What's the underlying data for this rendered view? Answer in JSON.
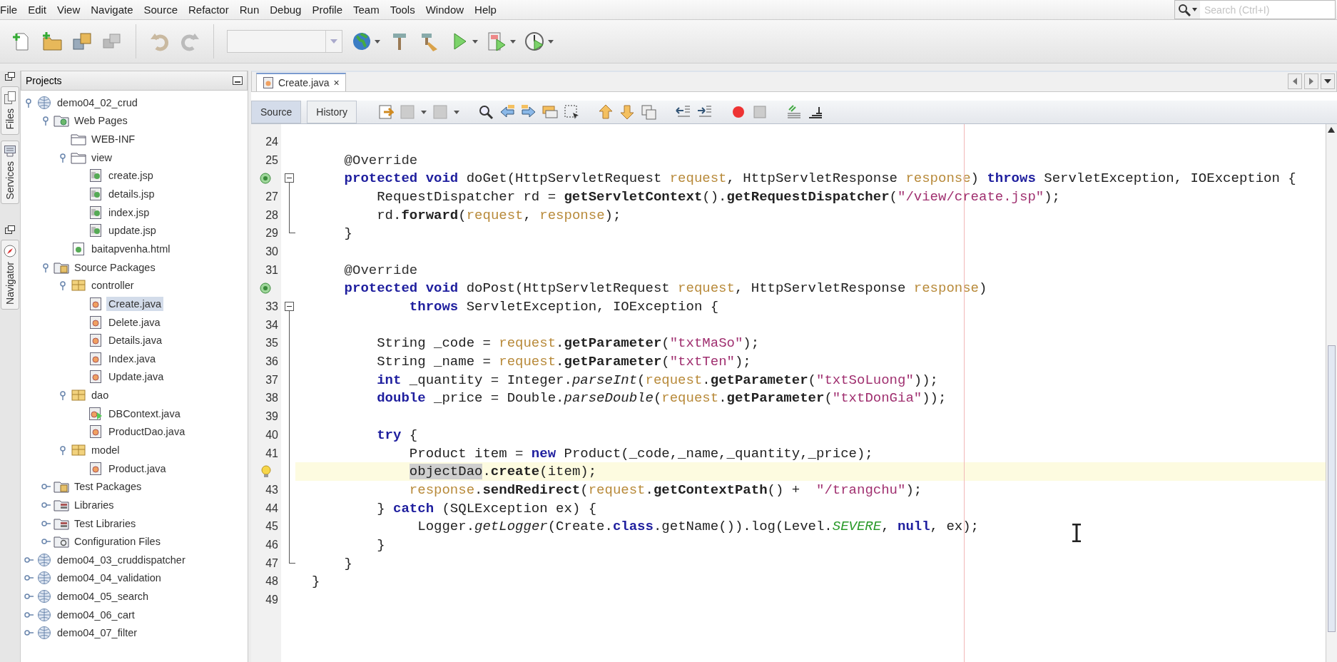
{
  "menu": [
    "File",
    "Edit",
    "View",
    "Navigate",
    "Source",
    "Refactor",
    "Run",
    "Debug",
    "Profile",
    "Team",
    "Tools",
    "Window",
    "Help"
  ],
  "search": {
    "placeholder": "Search (Ctrl+I)"
  },
  "side_tabs": [
    {
      "label": "Files"
    },
    {
      "label": "Services"
    },
    {
      "label": "Navigator"
    }
  ],
  "projects": {
    "title": "Projects",
    "tree": [
      {
        "label": "demo04_02_crud",
        "kind": "project",
        "selected": false,
        "expanded": true,
        "children": [
          {
            "label": "Web Pages",
            "kind": "web-pages",
            "selected": false,
            "expanded": true,
            "children": [
              {
                "label": "WEB-INF",
                "kind": "folder",
                "selected": false
              },
              {
                "label": "view",
                "kind": "folder",
                "selected": false,
                "expanded": true,
                "children": [
                  {
                    "label": "create.jsp",
                    "kind": "jsp",
                    "selected": false
                  },
                  {
                    "label": "details.jsp",
                    "kind": "jsp",
                    "selected": false
                  },
                  {
                    "label": "index.jsp",
                    "kind": "jsp",
                    "selected": false
                  },
                  {
                    "label": "update.jsp",
                    "kind": "jsp",
                    "selected": false
                  }
                ]
              },
              {
                "label": "baitapvenha.html",
                "kind": "html",
                "selected": false
              }
            ]
          },
          {
            "label": "Source Packages",
            "kind": "source-packages",
            "selected": false,
            "expanded": true,
            "children": [
              {
                "label": "controller",
                "kind": "package",
                "selected": false,
                "expanded": true,
                "children": [
                  {
                    "label": "Create.java",
                    "kind": "java",
                    "selected": true
                  },
                  {
                    "label": "Delete.java",
                    "kind": "java",
                    "selected": false
                  },
                  {
                    "label": "Details.java",
                    "kind": "java",
                    "selected": false
                  },
                  {
                    "label": "Index.java",
                    "kind": "java",
                    "selected": false
                  },
                  {
                    "label": "Update.java",
                    "kind": "java",
                    "selected": false
                  }
                ]
              },
              {
                "label": "dao",
                "kind": "package",
                "selected": false,
                "expanded": true,
                "children": [
                  {
                    "label": "DBContext.java",
                    "kind": "java-main",
                    "selected": false
                  },
                  {
                    "label": "ProductDao.java",
                    "kind": "java",
                    "selected": false
                  }
                ]
              },
              {
                "label": "model",
                "kind": "package",
                "selected": false,
                "expanded": true,
                "children": [
                  {
                    "label": "Product.java",
                    "kind": "java",
                    "selected": false
                  }
                ]
              }
            ]
          },
          {
            "label": "Test Packages",
            "kind": "test-packages",
            "selected": false,
            "expanded": false
          },
          {
            "label": "Libraries",
            "kind": "libraries",
            "selected": false,
            "expanded": false
          },
          {
            "label": "Test Libraries",
            "kind": "libraries",
            "selected": false,
            "expanded": false
          },
          {
            "label": "Configuration Files",
            "kind": "config",
            "selected": false,
            "expanded": false
          }
        ]
      },
      {
        "label": "demo04_03_cruddispatcher",
        "kind": "project",
        "selected": false,
        "expanded": false
      },
      {
        "label": "demo04_04_validation",
        "kind": "project",
        "selected": false,
        "expanded": false
      },
      {
        "label": "demo04_05_search",
        "kind": "project",
        "selected": false,
        "expanded": false
      },
      {
        "label": "demo04_06_cart",
        "kind": "project",
        "selected": false,
        "expanded": false
      },
      {
        "label": "demo04_07_filter",
        "kind": "project",
        "selected": false,
        "expanded": false
      }
    ]
  },
  "editor": {
    "tabs": [
      {
        "label": "Create.java",
        "selected": true,
        "close": "×"
      }
    ],
    "views": [
      {
        "label": "Source",
        "selected": true
      },
      {
        "label": "History",
        "selected": false
      }
    ],
    "lines": [
      {
        "number": "24",
        "kind": "plain",
        "current": false,
        "fold_start": false,
        "fold_end": false
      },
      {
        "number": "25",
        "kind": "plain",
        "current": false,
        "fold_start": false,
        "fold_end": false,
        "tokens": [
          {
            "text": "    @Override",
            "kind": "annotation"
          }
        ]
      },
      {
        "kind": "override",
        "current": false,
        "fold_start": true,
        "fold_end": false,
        "tokens": [
          {
            "text": "    protected",
            "kind": "keyword"
          },
          {
            "text": " void",
            "kind": "keyword"
          },
          {
            "text": " doGet(HttpServletRequest ",
            "kind": "plain"
          },
          {
            "text": "request",
            "kind": "param"
          },
          {
            "text": ", HttpServletResponse ",
            "kind": "plain"
          },
          {
            "text": "response",
            "kind": "param"
          },
          {
            "text": ") ",
            "kind": "plain"
          },
          {
            "text": "throws",
            "kind": "keyword"
          },
          {
            "text": " ServletException, IOException {",
            "kind": "plain"
          }
        ]
      },
      {
        "number": "27",
        "kind": "plain",
        "current": false,
        "fold_start": false,
        "fold_end": false,
        "tokens": [
          {
            "text": "        RequestDispatcher rd = ",
            "kind": "plain"
          },
          {
            "text": "getServletContext",
            "kind": "method"
          },
          {
            "text": "().",
            "kind": "plain"
          },
          {
            "text": "getRequestDispatcher",
            "kind": "method"
          },
          {
            "text": "(",
            "kind": "plain"
          },
          {
            "text": "\"/view/create.jsp\"",
            "kind": "string"
          },
          {
            "text": ");",
            "kind": "plain"
          }
        ]
      },
      {
        "number": "28",
        "kind": "plain",
        "current": false,
        "fold_start": false,
        "fold_end": false,
        "tokens": [
          {
            "text": "        rd.",
            "kind": "plain"
          },
          {
            "text": "forward",
            "kind": "method"
          },
          {
            "text": "(",
            "kind": "plain"
          },
          {
            "text": "request",
            "kind": "param"
          },
          {
            "text": ", ",
            "kind": "plain"
          },
          {
            "text": "response",
            "kind": "param"
          },
          {
            "text": ");",
            "kind": "plain"
          }
        ]
      },
      {
        "number": "29",
        "kind": "plain",
        "current": false,
        "fold_start": false,
        "fold_end": true,
        "tokens": [
          {
            "text": "    }",
            "kind": "plain"
          }
        ]
      },
      {
        "number": "30",
        "kind": "plain",
        "current": false,
        "fold_start": false,
        "fold_end": false
      },
      {
        "number": "31",
        "kind": "plain",
        "current": false,
        "fold_start": false,
        "fold_end": false,
        "tokens": [
          {
            "text": "    @Override",
            "kind": "annotation"
          }
        ]
      },
      {
        "kind": "override",
        "current": false,
        "fold_start": false,
        "fold_end": false,
        "tokens": [
          {
            "text": "    protected",
            "kind": "keyword"
          },
          {
            "text": " void",
            "kind": "keyword"
          },
          {
            "text": " doPost(HttpServletRequest ",
            "kind": "plain"
          },
          {
            "text": "request",
            "kind": "param"
          },
          {
            "text": ", HttpServletResponse ",
            "kind": "plain"
          },
          {
            "text": "response",
            "kind": "param"
          },
          {
            "text": ")",
            "kind": "plain"
          }
        ]
      },
      {
        "number": "33",
        "kind": "plain",
        "current": false,
        "fold_start": true,
        "fold_end": false,
        "tokens": [
          {
            "text": "            throws",
            "kind": "keyword"
          },
          {
            "text": " ServletException, IOException {",
            "kind": "plain"
          }
        ]
      },
      {
        "number": "34",
        "kind": "plain",
        "current": false,
        "fold_start": false,
        "fold_end": false
      },
      {
        "number": "35",
        "kind": "plain",
        "current": false,
        "fold_start": false,
        "fold_end": false,
        "tokens": [
          {
            "text": "        String _code = ",
            "kind": "plain"
          },
          {
            "text": "request",
            "kind": "param"
          },
          {
            "text": ".",
            "kind": "plain"
          },
          {
            "text": "getParameter",
            "kind": "method"
          },
          {
            "text": "(",
            "kind": "plain"
          },
          {
            "text": "\"txtMaSo\"",
            "kind": "string"
          },
          {
            "text": ");",
            "kind": "plain"
          }
        ]
      },
      {
        "number": "36",
        "kind": "plain",
        "current": false,
        "fold_start": false,
        "fold_end": false,
        "tokens": [
          {
            "text": "        String _name = ",
            "kind": "plain"
          },
          {
            "text": "request",
            "kind": "param"
          },
          {
            "text": ".",
            "kind": "plain"
          },
          {
            "text": "getParameter",
            "kind": "method"
          },
          {
            "text": "(",
            "kind": "plain"
          },
          {
            "text": "\"txtTen\"",
            "kind": "string"
          },
          {
            "text": ");",
            "kind": "plain"
          }
        ]
      },
      {
        "number": "37",
        "kind": "plain",
        "current": false,
        "fold_start": false,
        "fold_end": false,
        "tokens": [
          {
            "text": "        int",
            "kind": "keyword"
          },
          {
            "text": " _quantity = Integer.",
            "kind": "plain"
          },
          {
            "text": "parseInt",
            "kind": "static-method"
          },
          {
            "text": "(",
            "kind": "plain"
          },
          {
            "text": "request",
            "kind": "param"
          },
          {
            "text": ".",
            "kind": "plain"
          },
          {
            "text": "getParameter",
            "kind": "method"
          },
          {
            "text": "(",
            "kind": "plain"
          },
          {
            "text": "\"txtSoLuong\"",
            "kind": "string"
          },
          {
            "text": "));",
            "kind": "plain"
          }
        ]
      },
      {
        "number": "38",
        "kind": "plain",
        "current": false,
        "fold_start": false,
        "fold_end": false,
        "tokens": [
          {
            "text": "        double",
            "kind": "keyword"
          },
          {
            "text": " _price = Double.",
            "kind": "plain"
          },
          {
            "text": "parseDouble",
            "kind": "static-method"
          },
          {
            "text": "(",
            "kind": "plain"
          },
          {
            "text": "request",
            "kind": "param"
          },
          {
            "text": ".",
            "kind": "plain"
          },
          {
            "text": "getParameter",
            "kind": "method"
          },
          {
            "text": "(",
            "kind": "plain"
          },
          {
            "text": "\"txtDonGia\"",
            "kind": "string"
          },
          {
            "text": "));",
            "kind": "plain"
          }
        ]
      },
      {
        "number": "39",
        "kind": "plain",
        "current": false,
        "fold_start": false,
        "fold_end": false
      },
      {
        "number": "40",
        "kind": "plain",
        "current": false,
        "fold_start": false,
        "fold_end": false,
        "tokens": [
          {
            "text": "        try",
            "kind": "keyword"
          },
          {
            "text": " {",
            "kind": "plain"
          }
        ]
      },
      {
        "number": "41",
        "kind": "plain",
        "current": false,
        "fold_start": false,
        "fold_end": false,
        "tokens": [
          {
            "text": "            Product item = ",
            "kind": "plain"
          },
          {
            "text": "new",
            "kind": "keyword"
          },
          {
            "text": " Product(_code,_name,_quantity,_price);",
            "kind": "plain"
          }
        ]
      },
      {
        "kind": "hint",
        "current": true,
        "fold_start": false,
        "fold_end": false,
        "tokens": [
          {
            "text": "            objectDao",
            "kind": "highlight"
          },
          {
            "text": ".",
            "kind": "plain"
          },
          {
            "text": "create",
            "kind": "method"
          },
          {
            "text": "(item);",
            "kind": "plain"
          }
        ]
      },
      {
        "number": "43",
        "kind": "plain",
        "current": false,
        "fold_start": false,
        "fold_end": false,
        "tokens": [
          {
            "text": "            response",
            "kind": "param"
          },
          {
            "text": ".",
            "kind": "plain"
          },
          {
            "text": "sendRedirect",
            "kind": "method"
          },
          {
            "text": "(",
            "kind": "plain"
          },
          {
            "text": "request",
            "kind": "param"
          },
          {
            "text": ".",
            "kind": "plain"
          },
          {
            "text": "getContextPath",
            "kind": "method"
          },
          {
            "text": "() +  ",
            "kind": "plain"
          },
          {
            "text": "\"/trangchu\"",
            "kind": "string"
          },
          {
            "text": ");",
            "kind": "plain"
          }
        ]
      },
      {
        "number": "44",
        "kind": "plain",
        "current": false,
        "fold_start": false,
        "fold_end": false,
        "tokens": [
          {
            "text": "        } ",
            "kind": "plain"
          },
          {
            "text": "catch",
            "kind": "keyword"
          },
          {
            "text": " (SQLException ex) {",
            "kind": "plain"
          }
        ]
      },
      {
        "number": "45",
        "kind": "plain",
        "current": false,
        "fold_start": false,
        "fold_end": false,
        "tokens": [
          {
            "text": "             Logger.",
            "kind": "plain"
          },
          {
            "text": "getLogger",
            "kind": "static-method"
          },
          {
            "text": "(Create.",
            "kind": "plain"
          },
          {
            "text": "class",
            "kind": "keyword"
          },
          {
            "text": ".getName()).log(Level.",
            "kind": "plain"
          },
          {
            "text": "SEVERE",
            "kind": "field"
          },
          {
            "text": ", ",
            "kind": "plain"
          },
          {
            "text": "null",
            "kind": "keyword"
          },
          {
            "text": ", ex);",
            "kind": "plain"
          }
        ]
      },
      {
        "number": "46",
        "kind": "plain",
        "current": false,
        "fold_start": false,
        "fold_end": false,
        "tokens": [
          {
            "text": "        }",
            "kind": "plain"
          }
        ]
      },
      {
        "number": "47",
        "kind": "plain",
        "current": false,
        "fold_start": false,
        "fold_end": true,
        "tokens": [
          {
            "text": "    }",
            "kind": "plain"
          }
        ]
      },
      {
        "number": "48",
        "kind": "plain",
        "current": false,
        "fold_start": false,
        "fold_end": false,
        "tokens": [
          {
            "text": "}",
            "kind": "plain"
          }
        ]
      },
      {
        "number": "49",
        "kind": "plain",
        "current": false,
        "fold_start": false,
        "fold_end": false
      }
    ]
  }
}
